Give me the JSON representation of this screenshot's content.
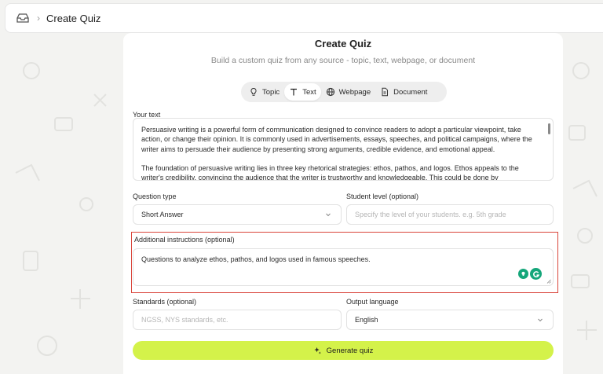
{
  "breadcrumb": {
    "current": "Create Quiz"
  },
  "header": {
    "title": "Create Quiz",
    "subtitle": "Build a custom quiz from any source - topic, text, webpage, or document"
  },
  "tabs": [
    {
      "label": "Topic",
      "icon": "lightbulb-icon"
    },
    {
      "label": "Text",
      "icon": "text-icon",
      "active": true
    },
    {
      "label": "Webpage",
      "icon": "globe-icon"
    },
    {
      "label": "Document",
      "icon": "document-icon"
    }
  ],
  "your_text": {
    "label": "Your text",
    "paragraph1": "Persuasive writing is a powerful form of communication designed to convince readers to adopt a particular viewpoint, take action, or change their opinion. It is commonly used in advertisements, essays, speeches, and political campaigns, where the writer aims to persuade their audience by presenting strong arguments, credible evidence, and emotional appeal.",
    "paragraph2": "The foundation of persuasive writing lies in three key rhetorical strategies: ethos, pathos, and logos. Ethos appeals to the writer's credibility, convincing the audience that the writer is trustworthy and knowledgeable. This could be done by"
  },
  "question_type": {
    "label": "Question type",
    "value": "Short Answer"
  },
  "student_level": {
    "label": "Student level (optional)",
    "placeholder": "Specify the level of your students. e.g. 5th grade"
  },
  "additional_instructions": {
    "label": "Additional instructions (optional)",
    "value": "Questions to analyze ethos, pathos, and logos used in famous speeches."
  },
  "standards": {
    "label": "Standards (optional)",
    "placeholder": "NGSS, NYS standards, etc."
  },
  "output_language": {
    "label": "Output language",
    "value": "English"
  },
  "generate_button": {
    "label": "Generate quiz"
  },
  "colors": {
    "accent": "#d4f24a",
    "highlight": "#d9453b",
    "grammarly": "#15a67a"
  }
}
